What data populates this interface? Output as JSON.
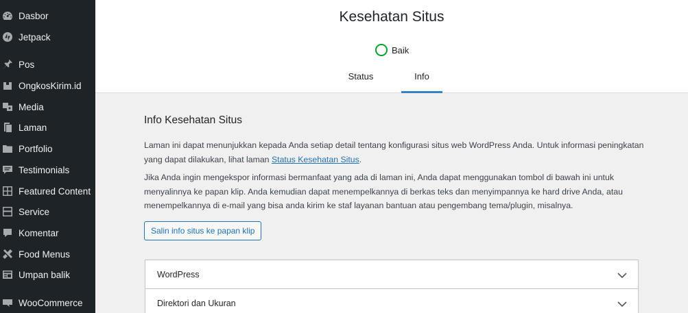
{
  "sidebar": {
    "items": [
      {
        "label": "Dasbor",
        "icon": "dashboard-icon"
      },
      {
        "label": "Jetpack",
        "icon": "jetpack-icon"
      },
      {
        "label": "Pos",
        "icon": "pin-icon"
      },
      {
        "label": "OngkosKirim.id",
        "icon": "box-icon"
      },
      {
        "label": "Media",
        "icon": "media-icon"
      },
      {
        "label": "Laman",
        "icon": "pages-icon"
      },
      {
        "label": "Portfolio",
        "icon": "folder-icon"
      },
      {
        "label": "Testimonials",
        "icon": "testimonial-icon"
      },
      {
        "label": "Featured Content",
        "icon": "grid-icon"
      },
      {
        "label": "Service",
        "icon": "layout-icon"
      },
      {
        "label": "Komentar",
        "icon": "comment-icon"
      },
      {
        "label": "Food Menus",
        "icon": "food-icon"
      },
      {
        "label": "Umpan balik",
        "icon": "feedback-icon"
      },
      {
        "label": "WooCommerce",
        "icon": "woocommerce-icon"
      }
    ]
  },
  "header": {
    "title": "Kesehatan Situs",
    "rating": "Baik",
    "tabs": [
      {
        "label": "Status",
        "active": false
      },
      {
        "label": "Info",
        "active": true
      }
    ]
  },
  "main": {
    "section_title": "Info Kesehatan Situs",
    "para1_text": "Laman ini dapat menunjukkan kepada Anda setiap detail tentang konfigurasi situs web WordPress Anda. Untuk informasi peningkatan yang dapat dilakukan, lihat laman ",
    "para1_link": "Status Kesehatan Situs",
    "para1_end": ".",
    "para2": "Jika Anda ingin mengekspor informasi bermanfaat yang ada di laman ini, Anda dapat menggunakan tombol di bawah ini untuk menyalinnya ke papan klip. Anda kemudian dapat menempelkannya di berkas teks dan menyimpannya ke hard drive Anda, atau menempelkannya di e-mail yang bisa anda kirim ke staf layanan bantuan atau pengembang tema/plugin, misalnya.",
    "copy_button": "Salin info situs ke papan klip",
    "accordion": [
      {
        "title": "WordPress"
      },
      {
        "title": "Direktori dan Ukuran"
      }
    ]
  },
  "colors": {
    "sidebar_bg": "#1d2327",
    "accent": "#2271b1",
    "good": "#00a32a"
  }
}
